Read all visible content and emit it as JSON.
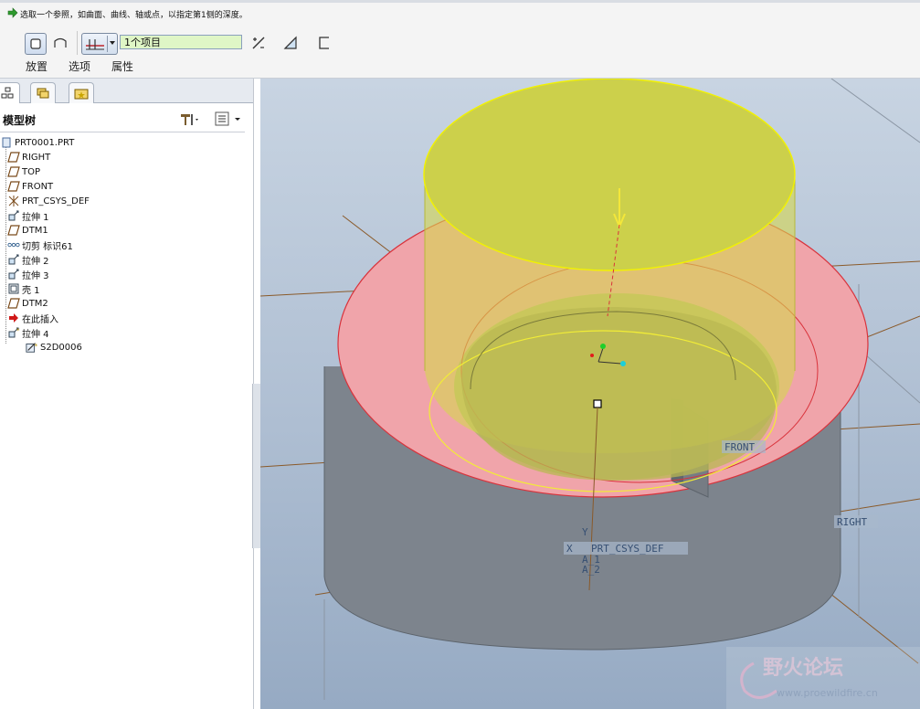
{
  "prompt": "选取一个参照，如曲面、曲线、轴或点，以指定第1侧的深度。",
  "dashboard": {
    "collector_value": "1个项目",
    "tabs": [
      "放置",
      "选项",
      "属性"
    ]
  },
  "model_tree": {
    "title": "模型树",
    "items": [
      {
        "label": "PRT0001.PRT",
        "icon": "part-icon"
      },
      {
        "label": "RIGHT",
        "icon": "datum-plane-icon"
      },
      {
        "label": "TOP",
        "icon": "datum-plane-icon"
      },
      {
        "label": "FRONT",
        "icon": "datum-plane-icon"
      },
      {
        "label": "PRT_CSYS_DEF",
        "icon": "csys-icon"
      },
      {
        "label": "拉伸 1",
        "icon": "extrude-icon"
      },
      {
        "label": "DTM1",
        "icon": "datum-plane-icon"
      },
      {
        "label": "切剪 标识61",
        "icon": "cut-icon"
      },
      {
        "label": "拉伸 2",
        "icon": "extrude-icon"
      },
      {
        "label": "拉伸 3",
        "icon": "extrude-icon"
      },
      {
        "label": "壳 1",
        "icon": "shell-icon"
      },
      {
        "label": "DTM2",
        "icon": "datum-plane-icon"
      },
      {
        "label": "在此插入",
        "icon": "insert-arrow-icon"
      },
      {
        "label": "拉伸 4",
        "icon": "extrude-icon"
      },
      {
        "label": "S2D0006",
        "icon": "sketch-icon"
      }
    ]
  },
  "viewport": {
    "labels": {
      "front": "FRONT",
      "right": "RIGHT",
      "csys": "PRT_CSYS_DEF",
      "axis_a1": "A_1",
      "axis_a2": "A_2",
      "axis_y": "Y",
      "axis_x": "X"
    },
    "watermark": {
      "title": "野火论坛",
      "url": "www.proewildfire.cn"
    },
    "colors": {
      "preview_yellow": "#d7da4e",
      "selected_surface_pink": "#f2a9ad",
      "body_gray": "#7c838c"
    }
  }
}
